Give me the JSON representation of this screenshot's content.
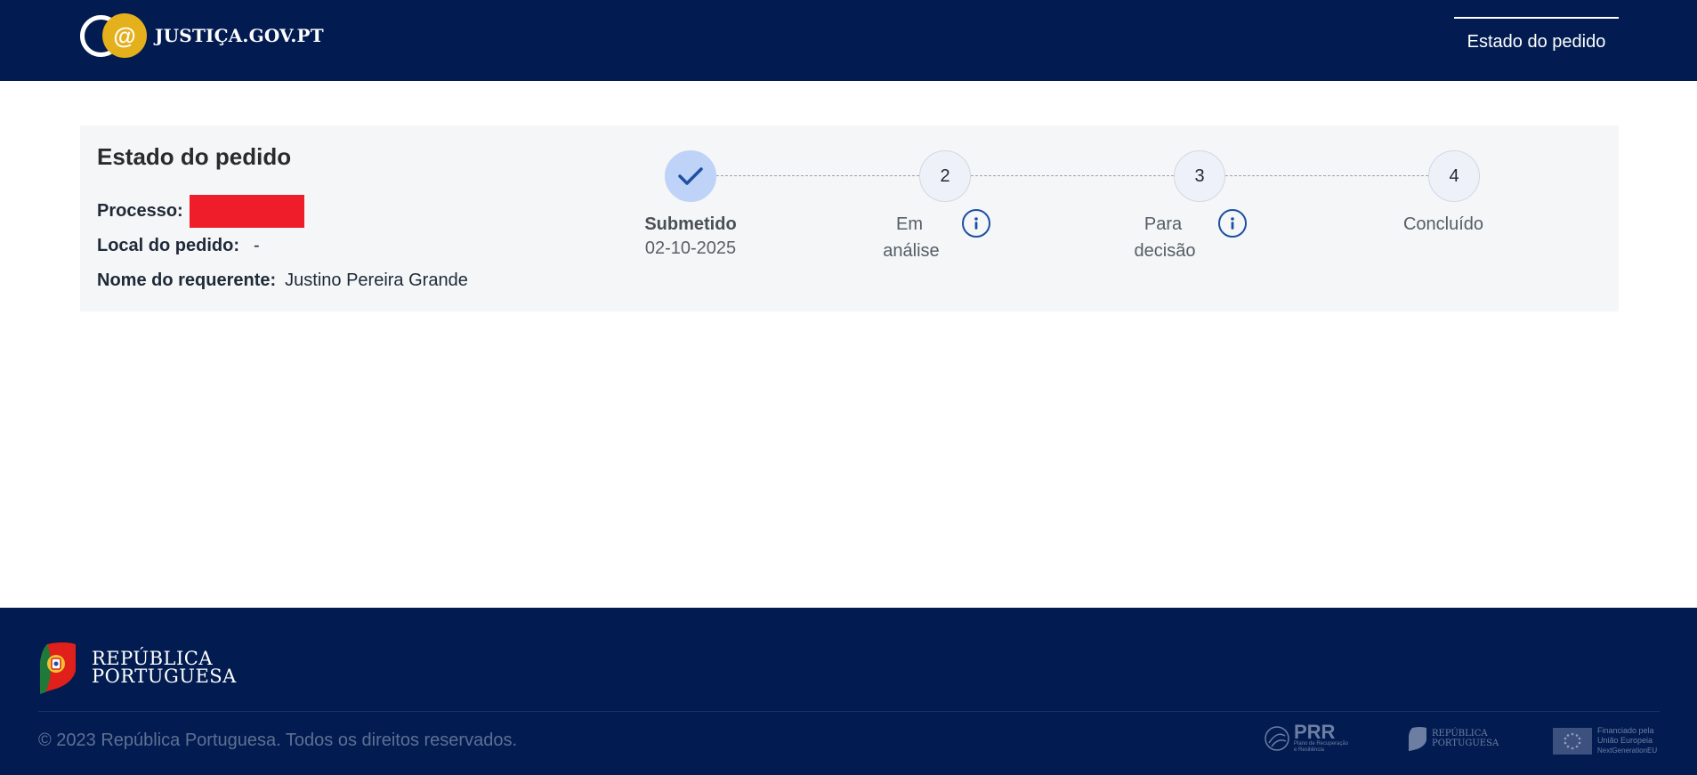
{
  "header": {
    "logo_text": "JUSTIÇA.GOV.PT",
    "nav_tab": "Estado do pedido"
  },
  "card": {
    "title": "Estado do pedido",
    "processo_label": "Processo:",
    "local_label": "Local do pedido:",
    "local_value": "-",
    "nome_label": "Nome do requerente:",
    "nome_value": "Justino Pereira Grande"
  },
  "stepper": {
    "steps": [
      {
        "label_line1": "Submetido",
        "label_line2": "",
        "date": "02-10-2025",
        "number": "",
        "status": "done"
      },
      {
        "label_line1": "Em",
        "label_line2": "análise",
        "number": "2",
        "status": "pending",
        "has_info": true
      },
      {
        "label_line1": "Para",
        "label_line2": "decisão",
        "number": "3",
        "status": "pending",
        "has_info": true
      },
      {
        "label_line1": "Concluído",
        "label_line2": "",
        "number": "4",
        "status": "pending",
        "has_info": false
      }
    ]
  },
  "footer": {
    "brand_line1": "REPÚBLICA",
    "brand_line2": "PORTUGUESA",
    "copyright": "© 2023 República Portuguesa. Todos os direitos reservados.",
    "partners": {
      "prr_main": "PRR",
      "prr_sub1": "Plano de Recuperação",
      "prr_sub2": "e Resiliência",
      "rep_line1": "REPÚBLICA",
      "rep_line2": "PORTUGUESA",
      "eu_line1": "Financiado pela",
      "eu_line2": "União Europeia",
      "eu_line3": "NextGenerationEU"
    }
  },
  "colors": {
    "header_bg": "#021c51",
    "accent_blue": "#1d4fa3",
    "done_circle": "#bfd2f7",
    "logo_gold": "#e4b01b",
    "redaction": "#ef1c2a"
  },
  "icons": {
    "check": "check-icon",
    "info": "info-icon",
    "at": "at-sign-icon"
  }
}
